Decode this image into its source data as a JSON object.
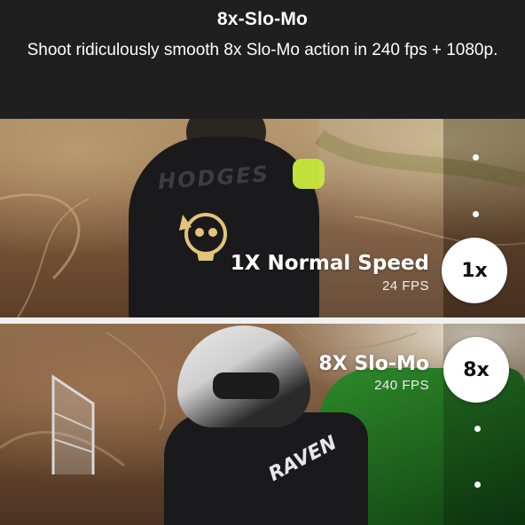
{
  "header": {
    "title": "8x-Slo-Mo",
    "subtitle": "Shoot ridiculously smooth 8x Slo-Mo action in 240 fps + 1080p."
  },
  "panel_normal": {
    "jersey_text": "HODGES",
    "mode_label": "1X Normal Speed",
    "fps_label": "24 FPS",
    "badge": "1x"
  },
  "panel_slomo": {
    "sleeve_text": "RAVEN",
    "mode_label": "8X Slo-Mo",
    "fps_label": "240 FPS",
    "badge": "8x"
  },
  "colors": {
    "header_bg": "#1f1f1f",
    "divider": "#f1f1f1",
    "badge_bg": "#ffffff",
    "accent_green": "#c2e03a"
  }
}
